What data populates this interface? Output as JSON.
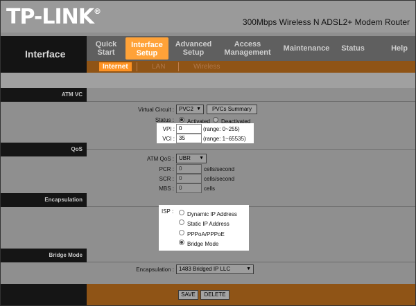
{
  "header": {
    "logo": "TP-LINK",
    "logo_mark": "®",
    "product": "300Mbps Wireless N ADSL2+ Modem Router",
    "section_title": "Interface"
  },
  "nav": {
    "tabs": [
      {
        "line1": "Quick",
        "line2": "Start"
      },
      {
        "line1": "Interface",
        "line2": "Setup",
        "active": true
      },
      {
        "line1": "Advanced",
        "line2": "Setup"
      },
      {
        "line1": "Access",
        "line2": "Management"
      },
      {
        "line1": "Maintenance",
        "line2": ""
      },
      {
        "line1": "Status",
        "line2": ""
      },
      {
        "line1": "Help",
        "line2": ""
      }
    ],
    "subtabs": [
      {
        "label": "Internet",
        "active": true
      },
      {
        "label": "LAN"
      },
      {
        "label": "Wireless"
      }
    ]
  },
  "atm_vc": {
    "section": "ATM VC",
    "virtual_circuit_label": "Virtual Circuit :",
    "virtual_circuit_value": "PVC2",
    "pvcs_summary_button": "PVCs Summary",
    "status_label": "Status :",
    "status_options": [
      "Activated",
      "Deactivated"
    ],
    "status_selected": "Activated",
    "vpi_label": "VPI :",
    "vpi_value": "0",
    "vpi_range": "(range: 0~255)",
    "vci_label": "VCI :",
    "vci_value": "35",
    "vci_range": "(range: 1~65535)"
  },
  "qos": {
    "section": "QoS",
    "atm_qos_label": "ATM QoS :",
    "atm_qos_value": "UBR",
    "pcr_label": "PCR :",
    "pcr_value": "0",
    "pcr_unit": "cells/second",
    "scr_label": "SCR :",
    "scr_value": "0",
    "scr_unit": "cells/second",
    "mbs_label": "MBS :",
    "mbs_value": "0",
    "mbs_unit": "cells"
  },
  "encapsulation": {
    "section": "Encapsulation",
    "isp_label": "ISP :",
    "options": [
      "Dynamic IP Address",
      "Static IP Address",
      "PPPoA/PPPoE",
      "Bridge Mode"
    ],
    "selected": "Bridge Mode"
  },
  "bridge_mode": {
    "section": "Bridge Mode",
    "encapsulation_label": "Encapsulation :",
    "encapsulation_value": "1483 Bridged IP LLC"
  },
  "footer": {
    "save": "SAVE",
    "delete": "DELETE"
  },
  "colors": {
    "accent_orange": "#ffa238",
    "brown_bar": "#8f5416",
    "dark": "#151515"
  }
}
